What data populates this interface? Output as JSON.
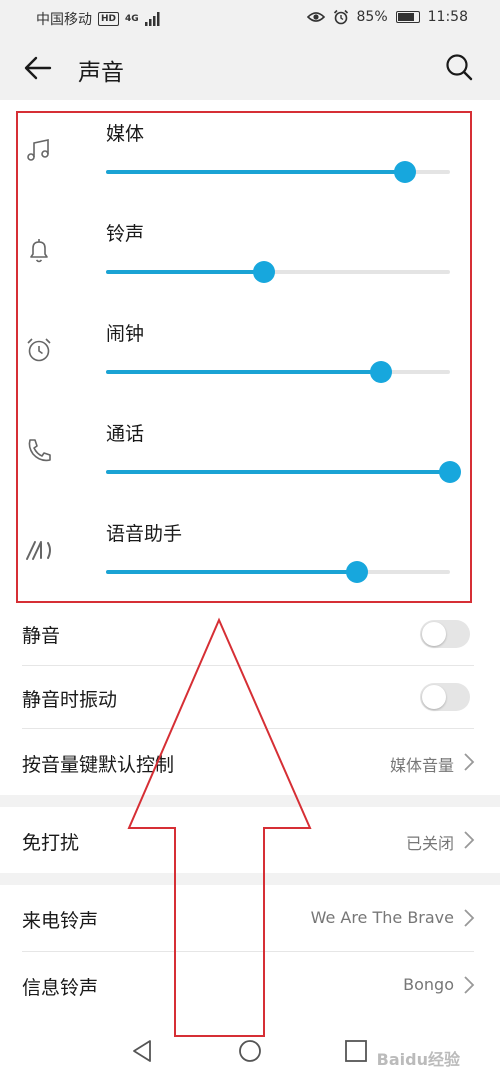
{
  "status_bar": {
    "carrier": "中国移动",
    "hd_badge": "HD",
    "network": "4G",
    "battery_percent": "85%",
    "time": "11:58",
    "battery_level": 0.85
  },
  "header": {
    "title": "声音"
  },
  "volumes": [
    {
      "label": "媒体",
      "icon": "music-note-icon",
      "level": 0.87
    },
    {
      "label": "铃声",
      "icon": "bell-icon",
      "level": 0.46
    },
    {
      "label": "闹钟",
      "icon": "alarm-clock-icon",
      "level": 0.8
    },
    {
      "label": "通话",
      "icon": "phone-icon",
      "level": 1.0
    },
    {
      "label": "语音助手",
      "icon": "voice-assistant-icon",
      "level": 0.73
    }
  ],
  "settings": {
    "mute": {
      "label": "静音",
      "on": false
    },
    "vibrate_on_mute": {
      "label": "静音时振动",
      "on": false
    },
    "volume_key": {
      "label": "按音量键默认控制",
      "value": "媒体音量"
    },
    "dnd": {
      "label": "免打扰",
      "value": "已关闭"
    },
    "ringtone": {
      "label": "来电铃声",
      "value": "We Are The Brave"
    },
    "message_tone": {
      "label": "信息铃声",
      "value": "Bongo"
    }
  },
  "watermark": "Baidu经验",
  "colors": {
    "accent": "#17a7dd",
    "annotation": "#d62f35"
  }
}
